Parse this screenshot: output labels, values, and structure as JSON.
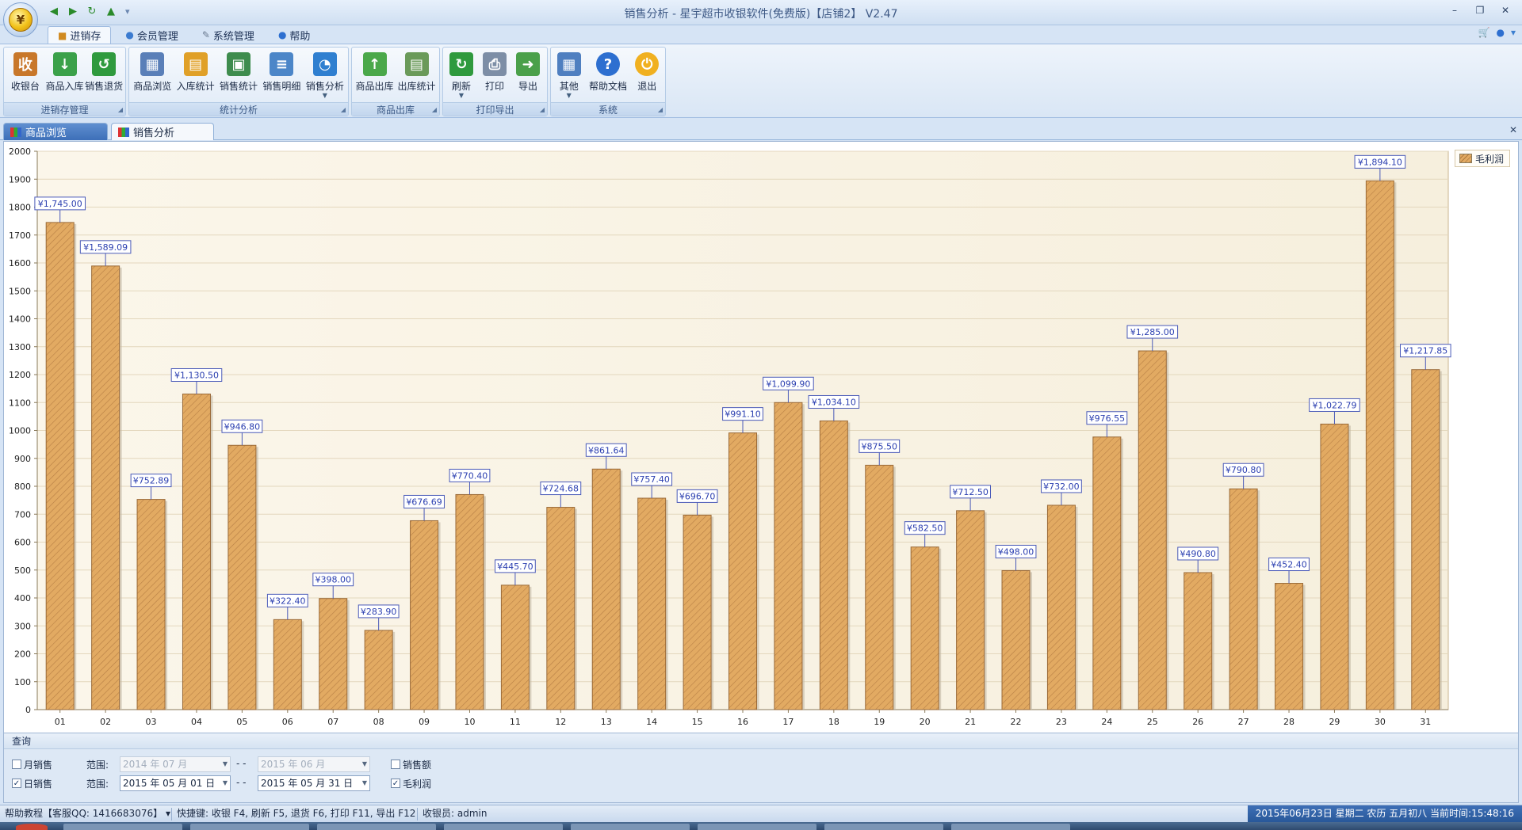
{
  "window": {
    "title": "销售分析 - 星宇超市收银软件(免费版)【店铺2】 V2.47",
    "controls": [
      "–",
      "❐",
      "✕"
    ]
  },
  "ribbon_tabs": [
    {
      "label": "进销存",
      "active": true
    },
    {
      "label": "会员管理",
      "active": false
    },
    {
      "label": "系统管理",
      "active": false
    },
    {
      "label": "帮助",
      "active": false
    }
  ],
  "ribbon_groups": [
    {
      "title": "进销存管理",
      "buttons": [
        {
          "label": "收银台",
          "icon": "cash-register-icon",
          "color": "#c8772a"
        },
        {
          "label": "商品入库",
          "icon": "stock-in-icon",
          "color": "#3ba14a"
        },
        {
          "label": "销售退货",
          "icon": "return-icon",
          "color": "#2f9a3e"
        }
      ]
    },
    {
      "title": "统计分析",
      "buttons": [
        {
          "label": "商品浏览",
          "icon": "browse-icon",
          "color": "#5a7fb8"
        },
        {
          "label": "入库统计",
          "icon": "stock-stats-icon",
          "color": "#e0a028"
        },
        {
          "label": "销售统计",
          "icon": "sales-stats-icon",
          "color": "#3e8c4e"
        },
        {
          "label": "销售明细",
          "icon": "sales-detail-icon",
          "color": "#4c86c8"
        },
        {
          "label": "销售分析",
          "icon": "pie-chart-icon",
          "color": "#2f7fd0",
          "dropdown": true
        }
      ]
    },
    {
      "title": "商品出库",
      "buttons": [
        {
          "label": "商品出库",
          "icon": "stock-out-icon",
          "color": "#4aa84a"
        },
        {
          "label": "出库统计",
          "icon": "out-stats-icon",
          "color": "#6a9a5a"
        }
      ]
    },
    {
      "title": "打印导出",
      "buttons": [
        {
          "label": "刷新",
          "icon": "refresh-icon",
          "color": "#2f9a3e",
          "dropdown": true
        },
        {
          "label": "打印",
          "icon": "printer-icon",
          "color": "#7d8ea6"
        },
        {
          "label": "导出",
          "icon": "export-icon",
          "color": "#4aa04a"
        }
      ]
    },
    {
      "title": "系统",
      "buttons": [
        {
          "label": "其他",
          "icon": "other-icon",
          "color": "#4f7fc0",
          "dropdown": true
        },
        {
          "label": "帮助文档",
          "icon": "help-icon",
          "color": "#2d6fd0"
        },
        {
          "label": "退出",
          "icon": "power-icon",
          "color": "#f0b020"
        }
      ]
    }
  ],
  "doc_tabs": [
    {
      "label": "商品浏览",
      "active": false
    },
    {
      "label": "销售分析",
      "active": true
    }
  ],
  "chart_data": {
    "type": "bar",
    "categories": [
      "01",
      "02",
      "03",
      "04",
      "05",
      "06",
      "07",
      "08",
      "09",
      "10",
      "11",
      "12",
      "13",
      "14",
      "15",
      "16",
      "17",
      "18",
      "19",
      "20",
      "21",
      "22",
      "23",
      "24",
      "25",
      "26",
      "27",
      "28",
      "29",
      "30",
      "31"
    ],
    "series": [
      {
        "name": "毛利润",
        "values": [
          1745.0,
          1589.09,
          752.89,
          1130.5,
          946.8,
          322.4,
          398.0,
          283.9,
          676.69,
          770.4,
          445.7,
          724.68,
          861.64,
          757.4,
          696.7,
          991.1,
          1099.9,
          1034.1,
          875.5,
          582.5,
          712.5,
          498.0,
          732.0,
          976.55,
          1285.0,
          490.8,
          790.8,
          452.4,
          1022.79,
          1894.1,
          1217.85
        ]
      }
    ],
    "data_labels": [
      "¥1,745.00",
      "¥1,589.09",
      "¥752.89",
      "¥1,130.50",
      "¥946.80",
      "¥322.40",
      "¥398.00",
      "¥283.90",
      "¥676.69",
      "¥770.40",
      "¥445.70",
      "¥724.68",
      "¥861.64",
      "¥757.40",
      "¥696.70",
      "¥991.10",
      "¥1,099.90",
      "¥1,034.10",
      "¥875.50",
      "¥582.50",
      "¥712.50",
      "¥498.00",
      "¥732.00",
      "¥976.55",
      "¥1,285.00",
      "¥490.80",
      "¥790.80",
      "¥452.40",
      "¥1,022.79",
      "¥1,894.10",
      "¥1,217.85"
    ],
    "y_ticks": [
      0,
      100,
      200,
      300,
      400,
      500,
      600,
      700,
      800,
      900,
      1000,
      1100,
      1200,
      1300,
      1400,
      1500,
      1600,
      1700,
      1800,
      1900,
      2000
    ],
    "ylim": [
      0,
      2000
    ],
    "grid": true,
    "legend_position": "top-right",
    "bar_color": "#e2aa62",
    "label_color": "#2b3fb0"
  },
  "query": {
    "header": "查询",
    "month_sales": {
      "label": "月销售",
      "checked": false
    },
    "day_sales": {
      "label": "日销售",
      "checked": true
    },
    "range_label": "范围:",
    "range_sep": "- -",
    "month_from": "2014 年 07 月",
    "month_to": "2015 年 06 月",
    "day_from": "2015 年 05 月 01 日",
    "day_to": "2015 年 05 月 31 日",
    "sales_amount": {
      "label": "销售额",
      "checked": false
    },
    "gross_profit": {
      "label": "毛利润",
      "checked": true
    }
  },
  "status": {
    "help": "帮助教程【客服QQ: 1416683076】",
    "shortcuts": "快捷键: 收银 F4, 刷新 F5, 退货 F6, 打印 F11, 导出 F12",
    "cashier": "收银员: admin",
    "datetime": "2015年06月23日 星期二 农历 五月初八 当前时间:15:48:16"
  }
}
